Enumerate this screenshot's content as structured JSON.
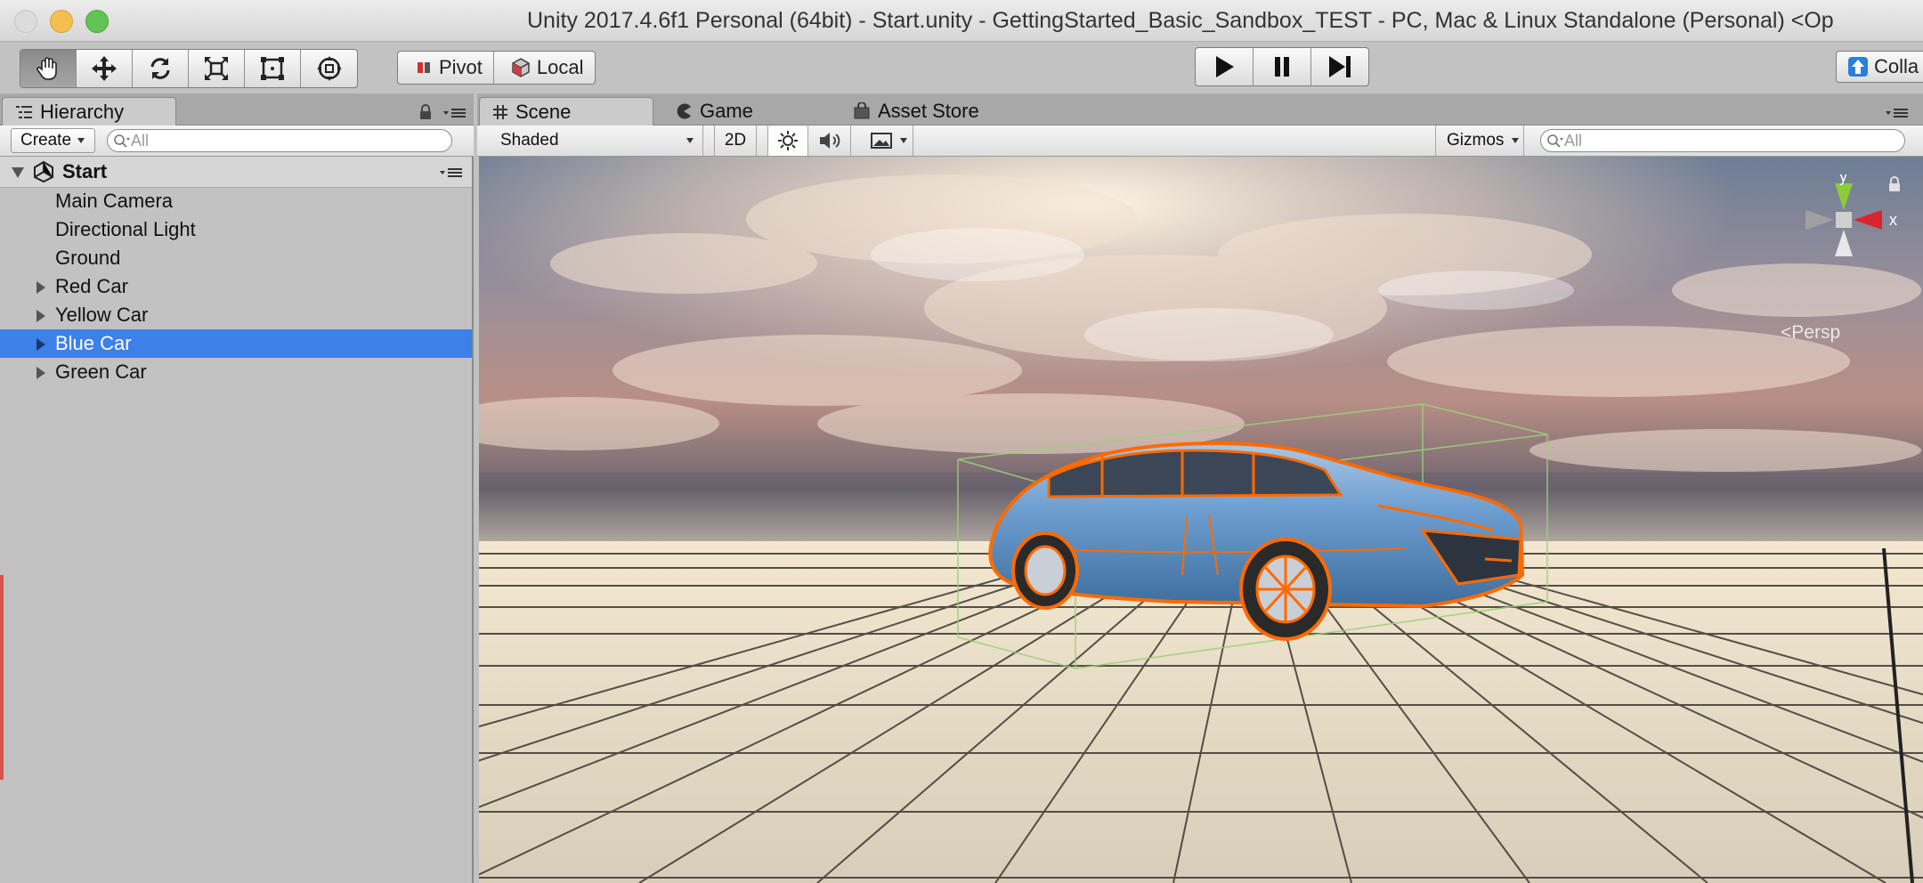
{
  "window": {
    "title": "Unity 2017.4.6f1 Personal (64bit) - Start.unity - GettingStarted_Basic_Sandbox_TEST - PC, Mac & Linux Standalone (Personal) <Op"
  },
  "toolbar": {
    "tools": [
      {
        "name": "hand-tool",
        "icon": "hand-icon"
      },
      {
        "name": "move-tool",
        "icon": "move-arrows-icon"
      },
      {
        "name": "rotate-tool",
        "icon": "rotate-icon"
      },
      {
        "name": "scale-tool",
        "icon": "scale-icon"
      },
      {
        "name": "rect-tool",
        "icon": "rect-icon"
      },
      {
        "name": "transform-tool",
        "icon": "transform-icon"
      }
    ],
    "pivot_label": "Pivot",
    "local_label": "Local",
    "collab_label": "Colla"
  },
  "hierarchy": {
    "tab_label": "Hierarchy",
    "create_label": "Create",
    "search_placeholder": "All",
    "scene_name": "Start",
    "items": [
      {
        "label": "Main Camera",
        "expandable": false
      },
      {
        "label": "Directional Light",
        "expandable": false
      },
      {
        "label": "Ground",
        "expandable": false
      },
      {
        "label": "Red Car",
        "expandable": true
      },
      {
        "label": "Yellow Car",
        "expandable": true
      },
      {
        "label": "Blue Car",
        "expandable": true,
        "selected": true
      },
      {
        "label": "Green Car",
        "expandable": true
      }
    ]
  },
  "scene_view": {
    "tabs": [
      {
        "label": "Scene",
        "icon": "grid-icon",
        "active": true
      },
      {
        "label": "Game",
        "icon": "pacman-icon",
        "active": false
      },
      {
        "label": "Asset Store",
        "icon": "bag-icon",
        "active": false
      }
    ],
    "shading_mode": "Shaded",
    "mode_2d_label": "2D",
    "gizmos_label": "Gizmos",
    "search_placeholder": "All",
    "projection_label": "Persp",
    "axis_y": "y",
    "axis_x": "x"
  },
  "colors": {
    "selection": "#3d80ea",
    "car_body": "#6f9fd0",
    "outline": "#ff6a00",
    "gizmo_x": "#d9262b",
    "gizmo_y": "#8ccc3a"
  }
}
